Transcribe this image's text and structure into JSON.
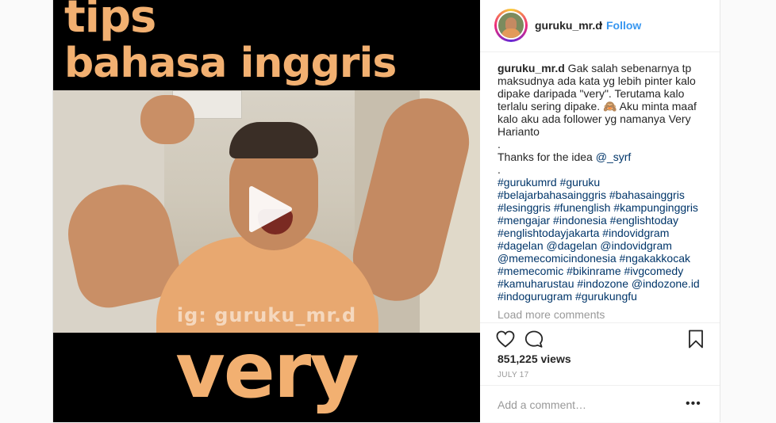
{
  "media": {
    "overlay_line1": "tips",
    "overlay_line2": "bahasa inggris",
    "watermark": "ig: guruku_mr.d",
    "overlay_bottom": "very",
    "overlay_color": "#f2b071"
  },
  "header": {
    "username": "guruku_mr.d",
    "separator": "•",
    "follow_label": "Follow",
    "follow_color": "#3897f0"
  },
  "caption": {
    "username": "guruku_mr.d",
    "lines": [
      " Gak salah sebenarnya tp",
      "maksudnya ada kata yg lebih pinter kalo",
      "dipake daripada \"very\". Terutama kalo",
      "terlalu sering dipake. 🙈 Aku minta maaf",
      "kalo aku ada follower yg namanya Very",
      "Harianto",
      ".",
      "Thanks for the idea ",
      ".",
      "#gurukumrd #guruku",
      "#belajarbahasainggris #bahasainggris",
      "#lesinggris #funenglish #kampunginggris",
      "#mengajar #indonesia #englishtoday",
      "#englishtodayjakarta #indovidgram",
      "#dagelan @dagelan @indovidgram",
      "@memecomicindonesia #ngakakkocak",
      "#memecomic #bikinrame #ivgcomedy",
      "#kamuharustau #indozone @indozone.id",
      "#indogurugram #gurukungfu"
    ],
    "mention_syrf": "@_syrf"
  },
  "load_more_label": "Load more comments",
  "actions": {
    "like_icon": "heart-icon",
    "comment_icon": "speech-bubble-icon",
    "save_icon": "bookmark-icon"
  },
  "views_label": "851,225 views",
  "date_label": "JULY 17",
  "comment": {
    "placeholder": "Add a comment…",
    "more_label": "•••"
  }
}
